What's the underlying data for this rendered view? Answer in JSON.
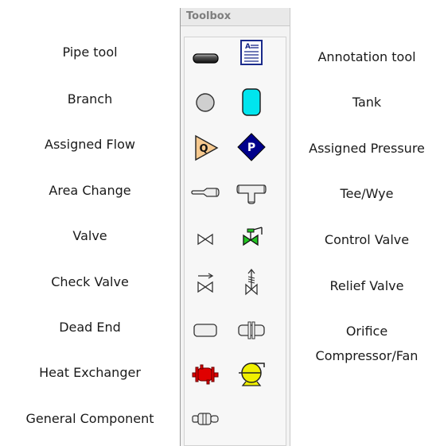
{
  "toolbox": {
    "title": "Toolbox"
  },
  "labels_left": [
    "Pipe tool",
    "Branch",
    "Assigned Flow",
    "Area Change",
    "Valve",
    "Check Valve",
    "Dead End",
    "Heat Exchanger",
    "General Component"
  ],
  "labels_right": [
    "Annotation tool",
    "Tank",
    "Assigned Pressure",
    "Tee/Wye",
    "Control Valve",
    "Relief Valve",
    "Orifice",
    "Compressor/Fan"
  ],
  "icons": {
    "assigned_flow_letter": "Q",
    "assigned_pressure_letter": "P"
  },
  "colors": {
    "tank_fill": "#00e5ee",
    "assigned_flow_fill": "#f6c98f",
    "assigned_pressure_fill": "#00008b",
    "control_valve_fill": "#22c522",
    "heat_exchanger_fill": "#e00000",
    "compressor_fill": "#f0f000"
  }
}
